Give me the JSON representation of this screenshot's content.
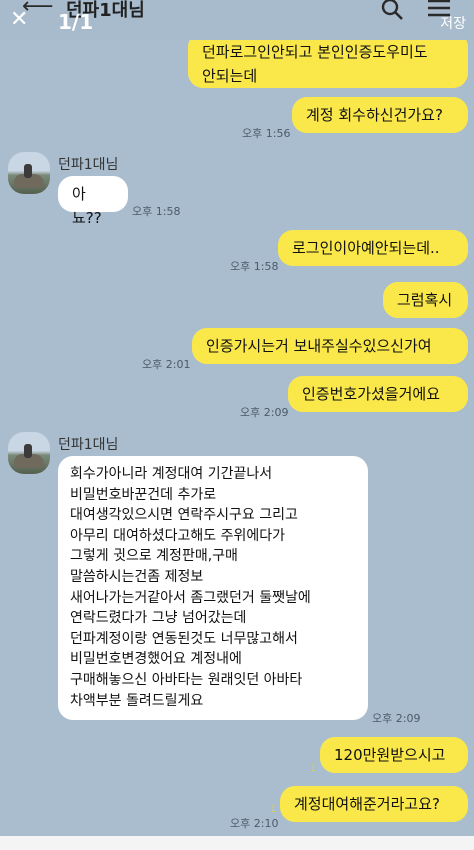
{
  "overlay": {
    "close": "✕",
    "count": "1/1",
    "save": "저장"
  },
  "header": {
    "title": "던파1대님"
  },
  "messages": {
    "m1": {
      "text": "던파로그인안되고 본인인증도우미도\n안되는데"
    },
    "m2": {
      "text": "계정 회수하신건가요?",
      "time": "오후 1:56"
    },
    "m3": {
      "sender": "던파1대님",
      "text": "아뇨??",
      "time": "오후 1:58"
    },
    "m4": {
      "text": "로그인이아예안되는데..",
      "time": "오후 1:58"
    },
    "m5": {
      "text": "그럼혹시"
    },
    "m6": {
      "text": "인증가시는거 보내주실수있으신가여",
      "time": "오후 2:01"
    },
    "m7": {
      "text": "인증번호가셨을거에요",
      "time": "오후 2:09"
    },
    "m8": {
      "sender": "던파1대님",
      "text": "회수가아니라 계정대여 기간끝나서\n비밀번호바꾼건데 추가로\n대여생각있으시면 연락주시구요 그리고\n아무리 대여하셨다고해도 주위에다가\n그렇게 귓으로 계정판매,구매\n말씀하시는건좀 제정보\n새어나가는거같아서 좀그랬던거 둘쨋날에\n연락드렸다가 그냥 넘어갔는데\n던파계정이랑 연동된것도 너무많고해서\n비밀번호변경했어요 계정내에\n구매해놓으신 아바타는 원래잇던 아바타\n차액부분 돌려드릴게요",
      "time": "오후 2:09"
    },
    "m9": {
      "text": "120만원받으시고",
      "read": "1"
    },
    "m10": {
      "text": "계정대여해준거라고요?",
      "time": "오후 2:10",
      "read": "1"
    }
  }
}
